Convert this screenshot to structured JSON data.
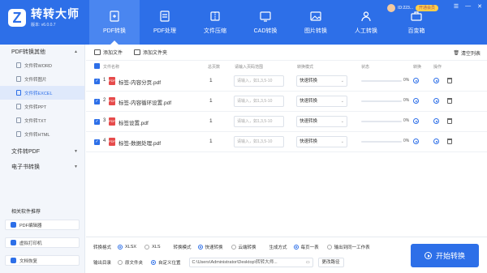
{
  "app": {
    "name": "转转大师",
    "version": "版本: v6.0.0.7"
  },
  "user": {
    "id": "ID:223...",
    "vip": "开通会员"
  },
  "colors": {
    "brand": "#2d6fe8",
    "pdf_icon": "#e64b4b"
  },
  "nav": [
    {
      "label": "PDF转换",
      "icon": "pdf-convert-icon"
    },
    {
      "label": "PDF处理",
      "icon": "pdf-process-icon"
    },
    {
      "label": "文件压缩",
      "icon": "compress-icon"
    },
    {
      "label": "CAD转换",
      "icon": "cad-icon"
    },
    {
      "label": "图片转换",
      "icon": "image-icon"
    },
    {
      "label": "人工转换",
      "icon": "person-icon"
    },
    {
      "label": "百变箱",
      "icon": "toolbox-icon"
    }
  ],
  "sidebar": {
    "group1": "PDF转换其他",
    "items": [
      "文件转WORD",
      "文件转图片",
      "文件转EXCEL",
      "文件转PPT",
      "文件转TXT",
      "文件转HTML"
    ],
    "group2": "文件转PDF",
    "group3": "电子书转换",
    "recommend_title": "相关软件推荐",
    "recommend": [
      "PDF编辑器",
      "虚拟打印机",
      "文档恢复"
    ]
  },
  "toolbar": {
    "add_file": "添加文件",
    "add_folder": "添加文件夹",
    "clear": "清空列表"
  },
  "table": {
    "headers": [
      "文件名称",
      "总页数",
      "请输入页码范围",
      "转换模式",
      "状态",
      "转换",
      "操作"
    ],
    "range_placeholder": "请输入，如1,3,5-10",
    "rows": [
      {
        "num": "1",
        "name": "标签-内容分页.pdf",
        "pages": "1",
        "mode": "快速转换",
        "progress": 0,
        "pct": "0%"
      },
      {
        "num": "2",
        "name": "标签-内容循环设置.pdf",
        "pages": "1",
        "mode": "快速转换",
        "progress": 0,
        "pct": "0%"
      },
      {
        "num": "3",
        "name": "标签设置.pdf",
        "pages": "1",
        "mode": "快速转换",
        "progress": 0,
        "pct": "0%"
      },
      {
        "num": "4",
        "name": "标签-数据处理.pdf",
        "pages": "1",
        "mode": "快速转换",
        "progress": 0,
        "pct": "0%"
      }
    ]
  },
  "bottom": {
    "format_label": "转换格式",
    "formats": [
      "XLSX",
      "XLS"
    ],
    "mode_label": "转换模式",
    "modes": [
      "快速转换",
      "云端转换"
    ],
    "gen_label": "生成方式",
    "gens": [
      "每页一表",
      "输出到同一工作表"
    ],
    "output_label": "输出目录",
    "outputs": [
      "原文件夹",
      "自定义位置"
    ],
    "path": "C:\\Users\\Administrator\\Desktop\\转转大师...",
    "change": "更改路径",
    "start": "开始转换"
  }
}
